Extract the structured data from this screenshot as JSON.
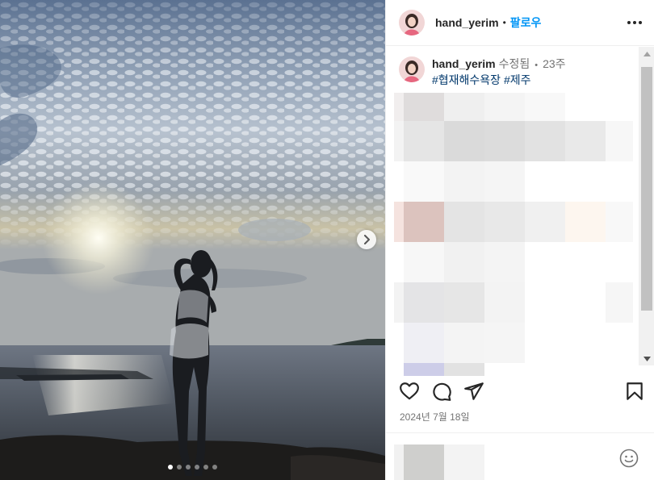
{
  "post": {
    "username": "hand_yerim",
    "follow_label": "팔로우",
    "separator": "•",
    "media": {
      "type": "photo",
      "slide_count": 6,
      "active_slide": 1,
      "next_icon": "chevron-right-icon"
    }
  },
  "caption": {
    "username": "hand_yerim",
    "edited_label": "수정됨",
    "separator": "•",
    "age": "23주",
    "tags": "#협재해수욕장 #제주"
  },
  "actions": {
    "like_icon": "heart-icon",
    "comment_icon": "comment-bubble-icon",
    "share_icon": "paper-plane-icon",
    "save_icon": "bookmark-icon",
    "date": "2024년 7월 18일"
  },
  "composer": {
    "emoji_icon": "smiley-icon"
  },
  "colors": {
    "accent": "#0095f6",
    "text": "#262626",
    "muted": "#737373",
    "tag": "#00376b"
  }
}
